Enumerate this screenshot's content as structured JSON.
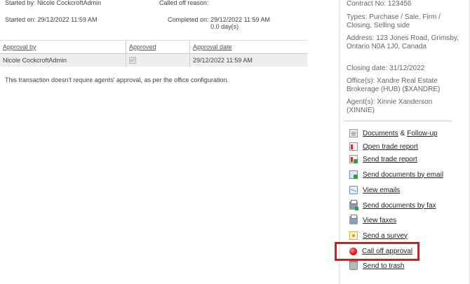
{
  "summary": {
    "started_by_label": "Started by:",
    "started_by": "Nicole CockcroftAdmin",
    "called_off_label": "Called off reason:",
    "called_off_reason": "",
    "started_on_label": "Started on:",
    "started_on": "29/12/2022 11:59 AM",
    "completed_on_label": "Completed on:",
    "completed_on": "29/12/2022 11:59 AM",
    "duration": "0.0 day(s)"
  },
  "approval_table": {
    "headers": [
      "Approval by",
      "Approved",
      "Approval date"
    ],
    "rows": [
      {
        "approval_by": "Nicole CockcroftAdmin",
        "approved": true,
        "approval_date": "29/12/2022 11:59 AM"
      }
    ]
  },
  "note": "This transaction doesn't require agents' approval, as per the office configuration.",
  "sidebar": {
    "contract_no": "Contract No:  123456",
    "types": "Types:  Purchase / Sale, Firm / Closing, Selling side",
    "address": "Address:  123 Jones Road, Grimsby, Ontario N0A 1J0, Canada",
    "closing_date": "Closing date:  31/12/2022",
    "offices": "Office(s):  Xandre Real Estate Brokerage (HUB) ($XANDRE)",
    "agents": "Agent(s):  Xinnie Xanderson (XINNIE)",
    "actions": {
      "documents": "Documents",
      "amp": "&",
      "follow_up": "Follow-up",
      "open_trade_report": "Open trade report",
      "send_trade_report": "Send trade report",
      "send_documents_email": "Send documents by email",
      "view_emails": "View emails",
      "send_documents_fax": "Send documents by fax",
      "view_faxes": "View faxes",
      "send_survey": "Send a survey",
      "call_off_approval": "Call off approval",
      "send_to_trash": "Send to trash"
    }
  },
  "colors": {
    "highlight": "#e8141c",
    "row_background": "#eeeeee"
  }
}
